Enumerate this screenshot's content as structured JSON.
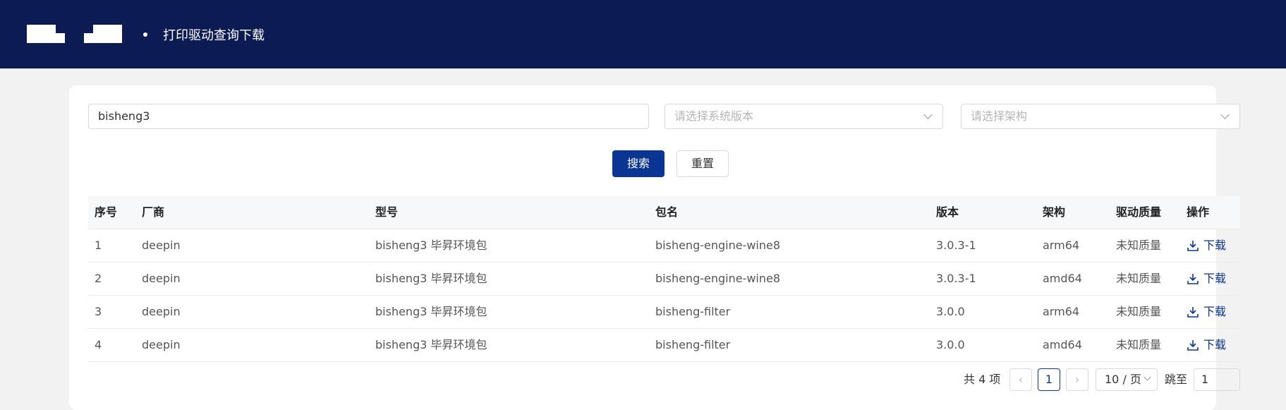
{
  "header": {
    "title": "打印驱动查询下载"
  },
  "search": {
    "keyword": "bisheng3",
    "os_placeholder": "请选择系统版本",
    "arch_placeholder": "请选择架构",
    "search_label": "搜索",
    "reset_label": "重置"
  },
  "table": {
    "columns": [
      "序号",
      "厂商",
      "型号",
      "包名",
      "版本",
      "架构",
      "驱动质量",
      "操作"
    ],
    "rows": [
      [
        "1",
        "deepin",
        "bisheng3 毕昇环境包",
        "bisheng-engine-wine8",
        "3.0.3-1",
        "arm64",
        "未知质量",
        "下载"
      ],
      [
        "2",
        "deepin",
        "bisheng3 毕昇环境包",
        "bisheng-engine-wine8",
        "3.0.3-1",
        "amd64",
        "未知质量",
        "下载"
      ],
      [
        "3",
        "deepin",
        "bisheng3 毕昇环境包",
        "bisheng-filter",
        "3.0.0",
        "arm64",
        "未知质量",
        "下载"
      ],
      [
        "4",
        "deepin",
        "bisheng3 毕昇环境包",
        "bisheng-filter",
        "3.0.0",
        "amd64",
        "未知质量",
        "下载"
      ]
    ]
  },
  "pagination": {
    "total": "共 4 项",
    "prev": "‹",
    "current": "1",
    "next": "›",
    "page_size": "10 / 页",
    "jump_label": "跳至",
    "jump_value": "1"
  },
  "colors": {
    "header_bg": "#0c1b54",
    "primary": "#0a3594"
  },
  "icons": {
    "download": "download-icon",
    "chevron": "chevron-down-icon"
  }
}
